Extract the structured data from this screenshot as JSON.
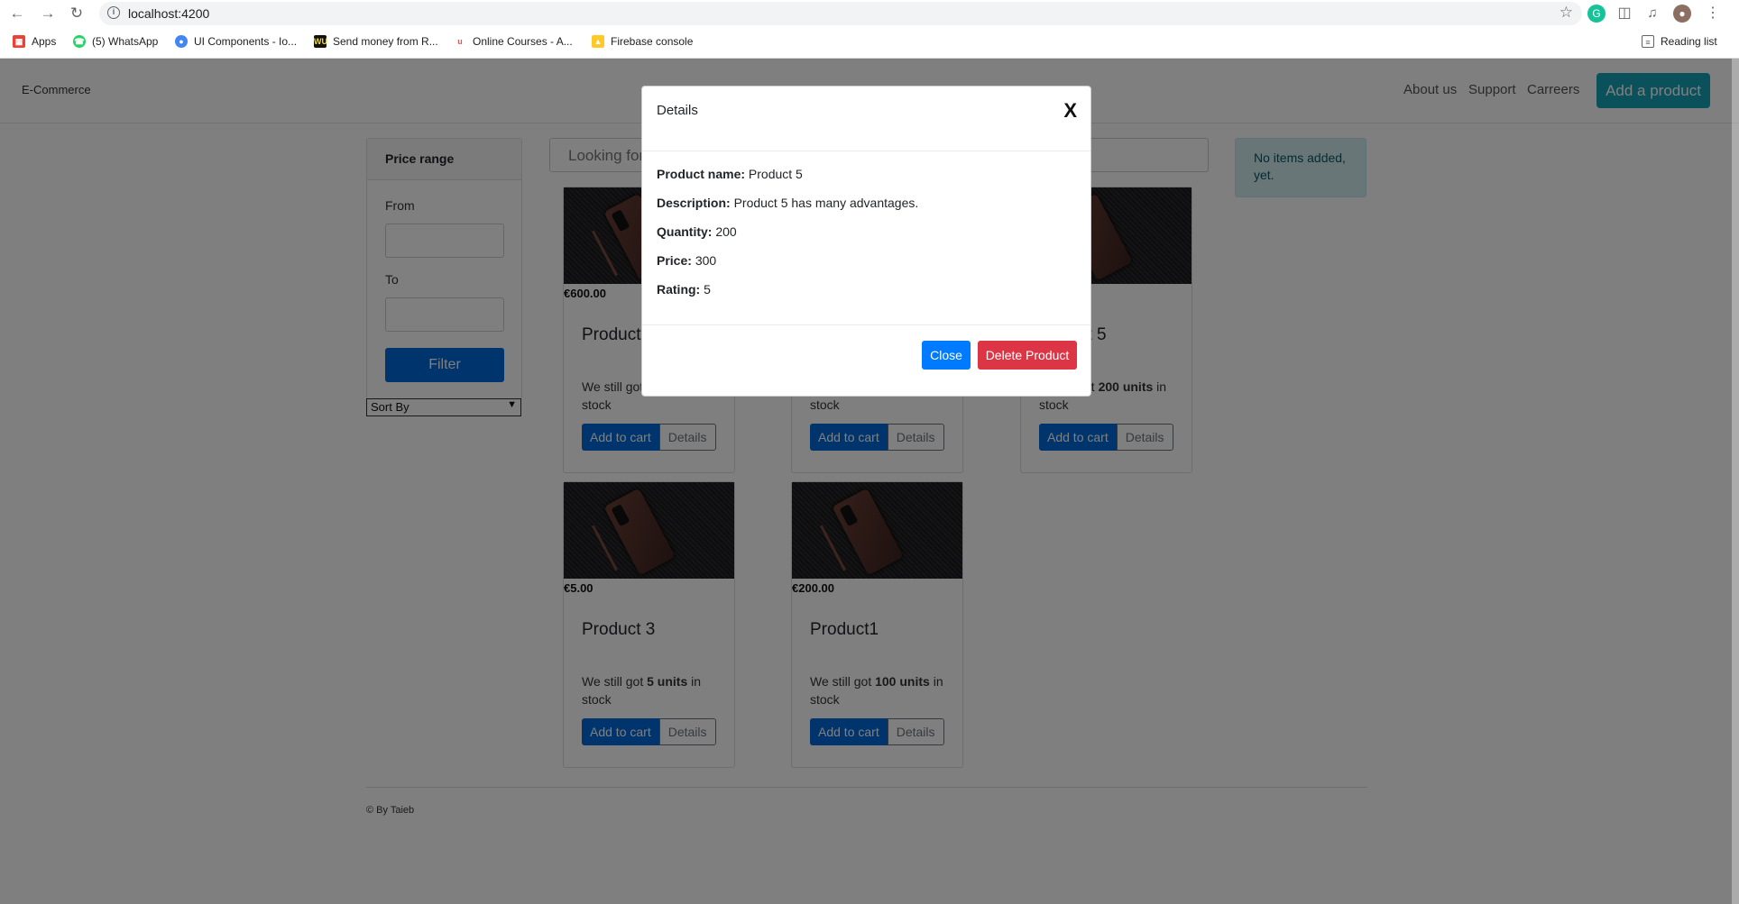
{
  "browser": {
    "url": "localhost:4200",
    "bookmarks": [
      "Apps",
      "(5) WhatsApp",
      "UI Components - Io...",
      "Send money from R...",
      "Online Courses - A...",
      "Firebase console"
    ],
    "reading_list": "Reading list"
  },
  "navbar": {
    "brand": "E-Commerce",
    "links": [
      "About us",
      "Support",
      "Carreers"
    ],
    "add_product": "Add a product"
  },
  "sidebar": {
    "header": "Price range",
    "from_label": "From",
    "to_label": "To",
    "filter_button": "Filter",
    "sort_by": "Sort By"
  },
  "search": {
    "placeholder": "Looking for"
  },
  "cart": {
    "message": "No items added, yet."
  },
  "products": [
    {
      "price": "€600.00",
      "title": "Product",
      "stock_prefix": "We still got",
      "stock_units": "",
      "stock_suffix": "stock"
    },
    {
      "price": "",
      "title": "",
      "stock_prefix": "",
      "stock_units": "",
      "stock_suffix": "stock"
    },
    {
      "price": "",
      "title": "ct 5",
      "stock_prefix": "ot",
      "stock_units": "200 units",
      "stock_suffix": "in stock"
    },
    {
      "price": "€5.00",
      "title": "Product 3",
      "stock_prefix": "We still got",
      "stock_units": "5 units",
      "stock_suffix": "in stock"
    },
    {
      "price": "€200.00",
      "title": "Product1",
      "stock_prefix": "We still got",
      "stock_units": "100 units",
      "stock_suffix": "in stock"
    }
  ],
  "card_buttons": {
    "add_to_cart": "Add to cart",
    "details": "Details"
  },
  "footer": {
    "text": "© By Taieb"
  },
  "modal": {
    "title": "Details",
    "close_x": "X",
    "fields": [
      {
        "label": "Product name:",
        "value": "Product 5"
      },
      {
        "label": "Description:",
        "value": "Product 5 has many advantages."
      },
      {
        "label": "Quantity:",
        "value": "200"
      },
      {
        "label": "Price:",
        "value": "300"
      },
      {
        "label": "Rating:",
        "value": "5"
      }
    ],
    "close_button": "Close",
    "delete_button": "Delete Product"
  }
}
